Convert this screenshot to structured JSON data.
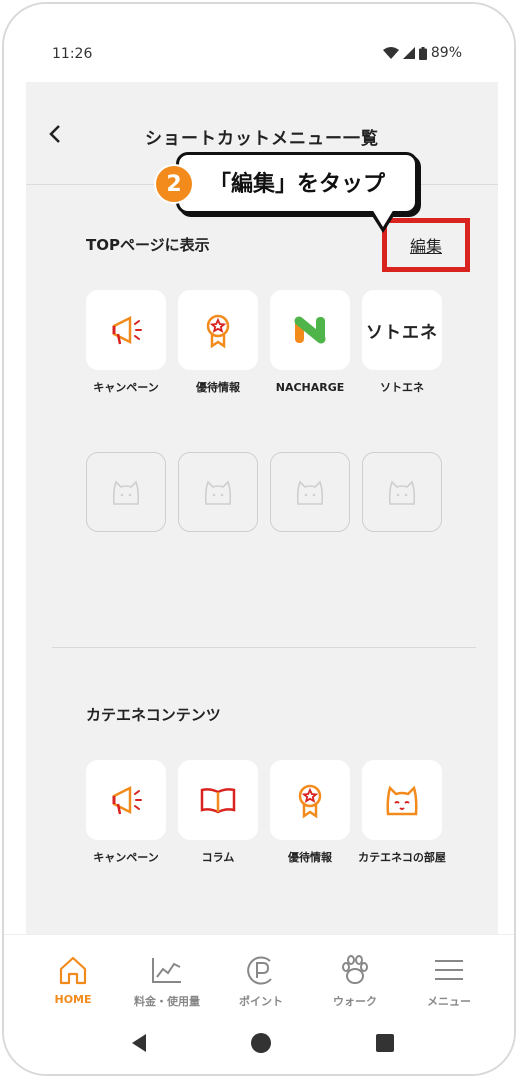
{
  "status_bar": {
    "time": "11:26",
    "battery": "89%"
  },
  "header": {
    "back_icon": "chevron-left-icon",
    "title": "ショートカットメニュー一覧"
  },
  "callout": {
    "step": "2",
    "text": "「編集」をタップ"
  },
  "top_section": {
    "title": "TOPページに表示",
    "edit_label": "編集",
    "tiles": [
      {
        "label": "キャンペーン",
        "icon": "megaphone-icon"
      },
      {
        "label": "優待情報",
        "icon": "medal-icon"
      },
      {
        "label": "NACHARGE",
        "icon": "nacharge-logo-icon"
      },
      {
        "label": "ソトエネ",
        "icon": "sotoene-logo",
        "logo_text": "ソトエネ"
      }
    ],
    "empty_slots": 4
  },
  "content_section": {
    "title": "カテエネコンテンツ",
    "tiles": [
      {
        "label": "キャンペーン",
        "icon": "megaphone-icon"
      },
      {
        "label": "コラム",
        "icon": "book-icon"
      },
      {
        "label": "優待情報",
        "icon": "medal-icon"
      },
      {
        "label": "カテエネコの部屋",
        "icon": "cat-face-icon"
      }
    ]
  },
  "tabbar": {
    "tabs": [
      {
        "label": "HOME",
        "icon": "home-icon",
        "active": true
      },
      {
        "label": "料金・使用量",
        "icon": "chart-icon",
        "active": false
      },
      {
        "label": "ポイント",
        "icon": "point-icon",
        "active": false
      },
      {
        "label": "ウォーク",
        "icon": "paw-icon",
        "active": false
      },
      {
        "label": "メニュー",
        "icon": "menu-icon",
        "active": false
      }
    ]
  },
  "colors": {
    "accent": "#f28b1c",
    "highlight": "#d8231f",
    "screen_bg": "#f1f1f1"
  }
}
